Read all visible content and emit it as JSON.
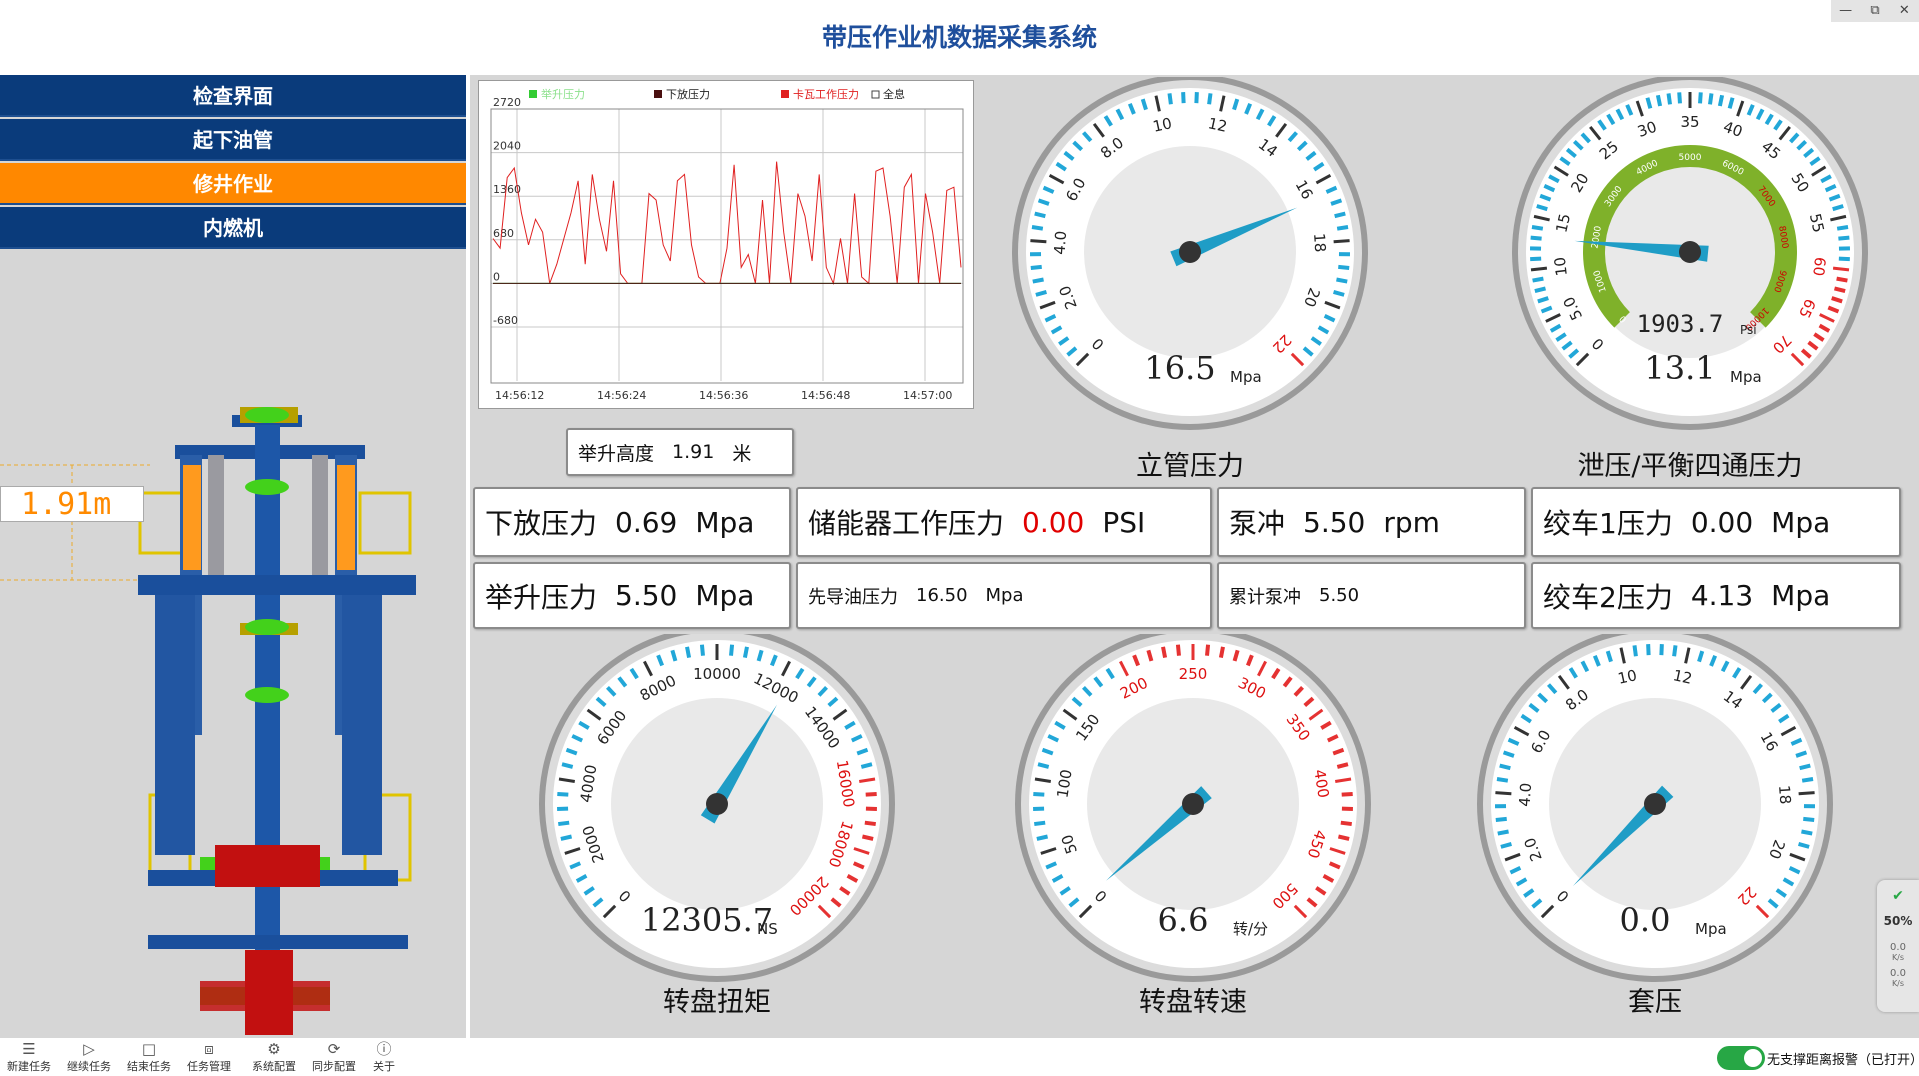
{
  "app": {
    "title": "带压作业机数据采集系统"
  },
  "window": {
    "min": "—",
    "restore": "⧉",
    "close": "✕"
  },
  "nav": [
    {
      "label": "检查界面",
      "active": false
    },
    {
      "label": "起下油管",
      "active": false
    },
    {
      "label": "修井作业",
      "active": true
    },
    {
      "label": "内燃机",
      "active": false
    }
  ],
  "rig": {
    "height_value": "1.91m"
  },
  "chart_data": {
    "type": "line",
    "legend": [
      "举升压力",
      "下放压力",
      "卡瓦工作压力",
      "全息"
    ],
    "colors": {
      "lift": "#33cc33",
      "down": "#4a1010",
      "slip": "#e02020"
    },
    "ylim": [
      -680,
      2720
    ],
    "yticks": [
      "2720",
      "2040",
      "1360",
      "680",
      "0",
      "-680"
    ],
    "xticks": [
      "14:56:12",
      "14:56:24",
      "14:56:36",
      "14:56:48",
      "14:57:00"
    ],
    "series": [
      {
        "name": "卡瓦工作压力",
        "values": [
          700,
          550,
          1650,
          1800,
          1100,
          600,
          1000,
          800,
          0,
          300,
          700,
          1100,
          1600,
          300,
          1700,
          1000,
          500,
          1600,
          150,
          0,
          0,
          0,
          1400,
          1300,
          600,
          350,
          1600,
          1700,
          600,
          100,
          0,
          0,
          0,
          550,
          1850,
          250,
          450,
          0,
          1300,
          0,
          1900,
          800,
          0,
          1400,
          1050,
          350,
          1700,
          250,
          0,
          700,
          0,
          1400,
          100,
          0,
          1750,
          1800,
          1050,
          0,
          1500,
          1700,
          0,
          1400,
          800,
          0,
          1450,
          1500,
          250
        ]
      },
      {
        "name": "举升压力",
        "values": [
          0,
          0
        ]
      },
      {
        "name": "下放压力",
        "values": [
          0,
          0
        ]
      }
    ]
  },
  "lift_height": {
    "label": "举升高度",
    "value": "1.91",
    "unit": "米"
  },
  "fields": {
    "down_pressure": {
      "label": "下放压力",
      "value": "0.69",
      "unit": "Mpa"
    },
    "accumulator": {
      "label": "储能器工作压力",
      "value": "0.00",
      "unit": "PSI"
    },
    "pump_stroke": {
      "label": "泵冲",
      "value": "5.50",
      "unit": "rpm"
    },
    "winch1": {
      "label": "绞车1压力",
      "value": "0.00",
      "unit": "Mpa"
    },
    "lift_pressure": {
      "label": "举升压力",
      "value": "5.50",
      "unit": "Mpa"
    },
    "pilot_oil": {
      "label": "先导油压力",
      "value": "16.50",
      "unit": "Mpa"
    },
    "total_stroke": {
      "label": "累计泵冲",
      "value": "5.50"
    },
    "winch2": {
      "label": "绞车2压力",
      "value": "4.13",
      "unit": "Mpa"
    }
  },
  "gauges": {
    "standpipe": {
      "caption": "立管压力",
      "value": "16.5",
      "unit": "Mpa",
      "reading": 16.5,
      "max": 22,
      "ticks": [
        "0",
        "2.0",
        "4.0",
        "6.0",
        "8.0",
        "10",
        "12",
        "14",
        "16",
        "18",
        "20",
        "22"
      ],
      "red_from": 11
    },
    "relief": {
      "caption": "泄压/平衡四通压力",
      "value": "13.1",
      "unit": "Mpa",
      "psi_value": "1903.7",
      "psi_unit": "Psi",
      "reading": 13.1,
      "max": 70,
      "ticks": [
        "0",
        "5.0",
        "10",
        "15",
        "20",
        "25",
        "30",
        "35",
        "40",
        "45",
        "50",
        "55",
        "60",
        "65",
        "70"
      ],
      "red_from": 12,
      "inner_ticks": [
        "0",
        "1000",
        "2000",
        "3000",
        "4000",
        "5000",
        "6000",
        "7000",
        "8000",
        "9000",
        "10000"
      ]
    },
    "torque": {
      "caption": "转盘扭矩",
      "value": "12305.7",
      "unit": "NS",
      "reading": 12305.7,
      "max": 20000,
      "ticks": [
        "0",
        "2000",
        "4000",
        "6000",
        "8000",
        "10000",
        "12000",
        "14000",
        "16000",
        "18000",
        "20000"
      ],
      "red_from": 8
    },
    "speed": {
      "caption": "转盘转速",
      "value": "6.6",
      "unit": "转/分",
      "reading": 6.6,
      "max": 500,
      "ticks": [
        "0",
        "50",
        "100",
        "150",
        "200",
        "250",
        "300",
        "350",
        "400",
        "450",
        "500"
      ],
      "red_from": 4
    },
    "casing": {
      "caption": "套压",
      "value": "0.0",
      "unit": "Mpa",
      "reading": 0,
      "max": 22,
      "ticks": [
        "0",
        "2.0",
        "4.0",
        "6.0",
        "8.0",
        "10",
        "12",
        "14",
        "16",
        "18",
        "20",
        "22"
      ],
      "red_from": 11
    }
  },
  "toolbar": [
    {
      "label": "新建任务",
      "icon": "☰"
    },
    {
      "label": "继续任务",
      "icon": "▷"
    },
    {
      "label": "结束任务",
      "icon": "□"
    },
    {
      "label": "任务管理",
      "icon": "⧈"
    },
    {
      "label": "系统配置",
      "icon": "⚙"
    },
    {
      "label": "同步配置",
      "icon": "⟳"
    },
    {
      "label": "关于",
      "icon": "ⓘ"
    }
  ],
  "alarm_toggle": {
    "label": "无支撑距离报警（已打开）"
  },
  "network": {
    "percent": "50%",
    "up": "0.0",
    "down": "0.0",
    "unit": "K/s"
  }
}
